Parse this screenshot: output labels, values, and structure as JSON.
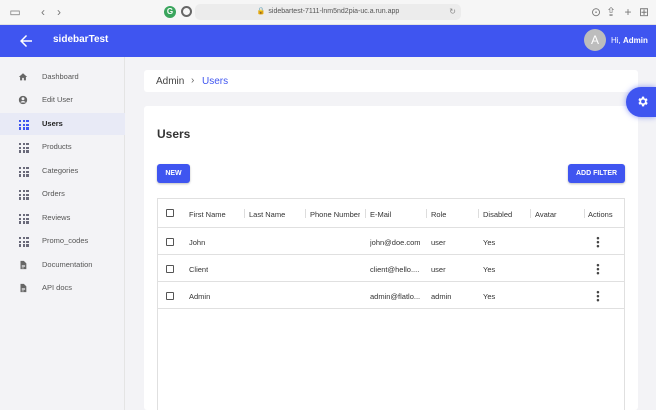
{
  "browser": {
    "url": "sidebartest-7111-lnm5nd2pia-uc.a.run.app",
    "ext_g_letter": "G"
  },
  "appbar": {
    "title": "sidebarTest",
    "avatar_letter": "A",
    "greeting_prefix": "Hi,",
    "user_name": "Admin",
    "color": "#3f55f0"
  },
  "sidebar": {
    "items": [
      {
        "label": "Dashboard",
        "icon": "home-icon"
      },
      {
        "label": "Edit User",
        "icon": "account-circle-icon"
      },
      {
        "label": "Users",
        "icon": "grid-icon",
        "active": true
      },
      {
        "label": "Products",
        "icon": "grid-icon"
      },
      {
        "label": "Categories",
        "icon": "grid-icon"
      },
      {
        "label": "Orders",
        "icon": "grid-icon"
      },
      {
        "label": "Reviews",
        "icon": "grid-icon"
      },
      {
        "label": "Promo_codes",
        "icon": "grid-icon"
      },
      {
        "label": "Documentation",
        "icon": "document-icon"
      },
      {
        "label": "API docs",
        "icon": "document-icon"
      }
    ]
  },
  "breadcrumb": {
    "root": "Admin",
    "separator": "›",
    "current": "Users"
  },
  "main": {
    "title": "Users",
    "new_label": "NEW",
    "filter_label": "ADD FILTER"
  },
  "table": {
    "columns": [
      "First Name",
      "Last Name",
      "Phone Number",
      "E-Mail",
      "Role",
      "Disabled",
      "Avatar",
      "Actions"
    ],
    "rows": [
      {
        "first_name": "John",
        "last_name": "",
        "phone": "",
        "email": "john@doe.com",
        "role": "user",
        "disabled": "Yes",
        "avatar": ""
      },
      {
        "first_name": "Client",
        "last_name": "",
        "phone": "",
        "email": "client@hello....",
        "role": "user",
        "disabled": "Yes",
        "avatar": ""
      },
      {
        "first_name": "Admin",
        "last_name": "",
        "phone": "",
        "email": "admin@flatlo...",
        "role": "admin",
        "disabled": "Yes",
        "avatar": ""
      }
    ],
    "actions_glyph": "⋮"
  }
}
